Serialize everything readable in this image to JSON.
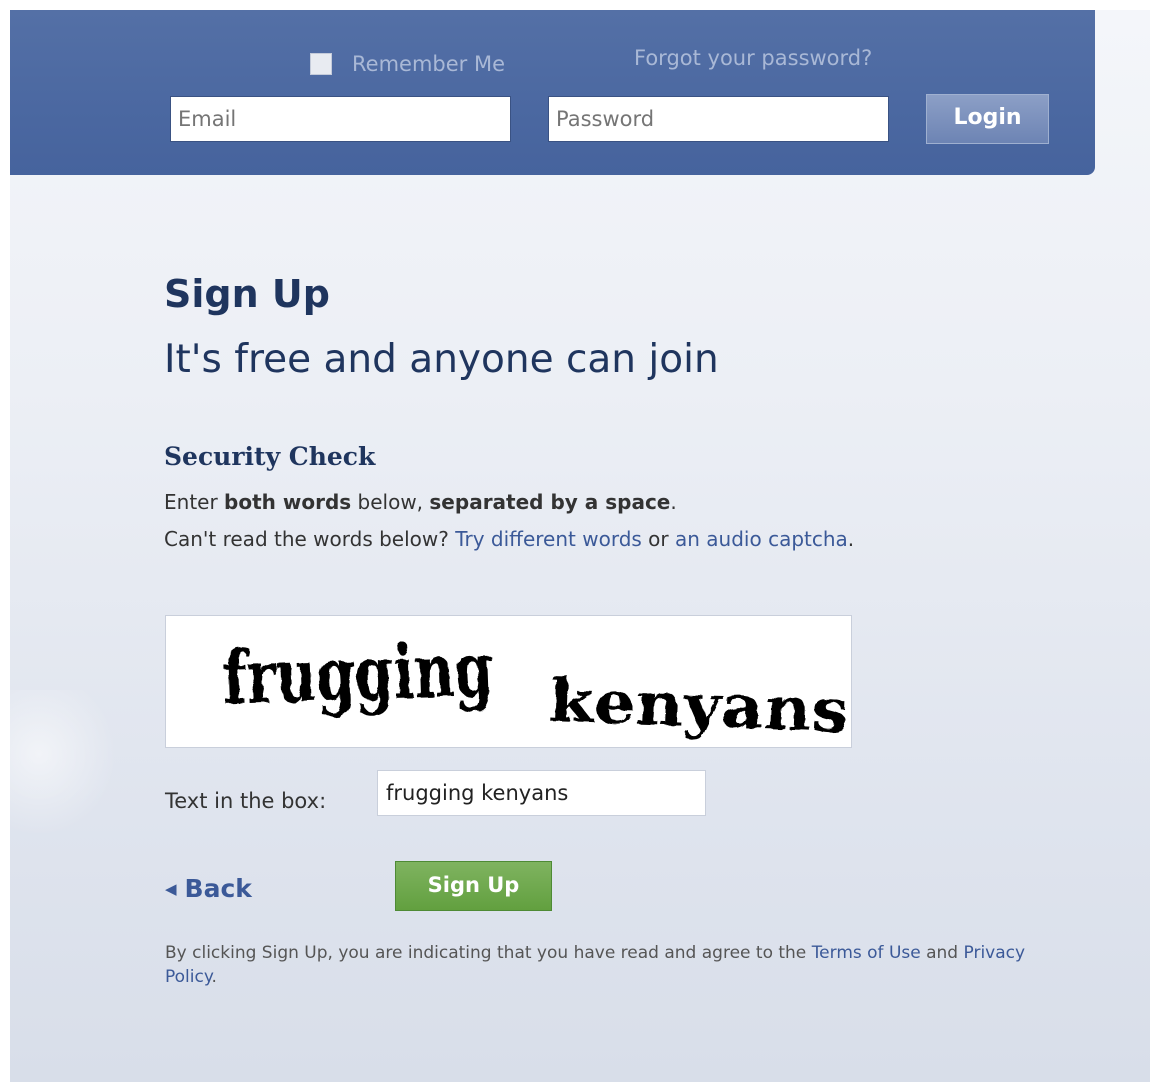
{
  "header": {
    "remember_label": "Remember Me",
    "forgot_label": "Forgot your password?",
    "email_placeholder": "Email",
    "password_placeholder": "Password",
    "login_label": "Login"
  },
  "main": {
    "title": "Sign Up",
    "subtitle": "It's free and anyone can join",
    "security": {
      "title": "Security Check",
      "enter_prefix": "Enter",
      "both_words": "both words",
      "below": "below,",
      "separated": "separated by a space",
      "period": ".",
      "cant_read": "Can't read the words below?",
      "try_different": "Try different words",
      "or": "or",
      "audio_captcha": "an audio captcha",
      "end_period": "."
    },
    "captcha": {
      "word1": "frugging",
      "word2": "kenyans"
    },
    "text_box_label": "Text in the box:",
    "text_box_value": "frugging kenyans",
    "back_label": "Back",
    "signup_button_label": "Sign Up",
    "terms": {
      "prefix": "By clicking Sign Up, you are indicating that you have read and agree to the",
      "terms_link": "Terms of Use",
      "and": "and",
      "privacy_link": "Privacy Policy",
      "suffix": "."
    }
  },
  "colors": {
    "header_blue": "#4b68a1",
    "link_blue": "#3b5998",
    "signup_green": "#62a03f",
    "heading_navy": "#1f355e"
  }
}
